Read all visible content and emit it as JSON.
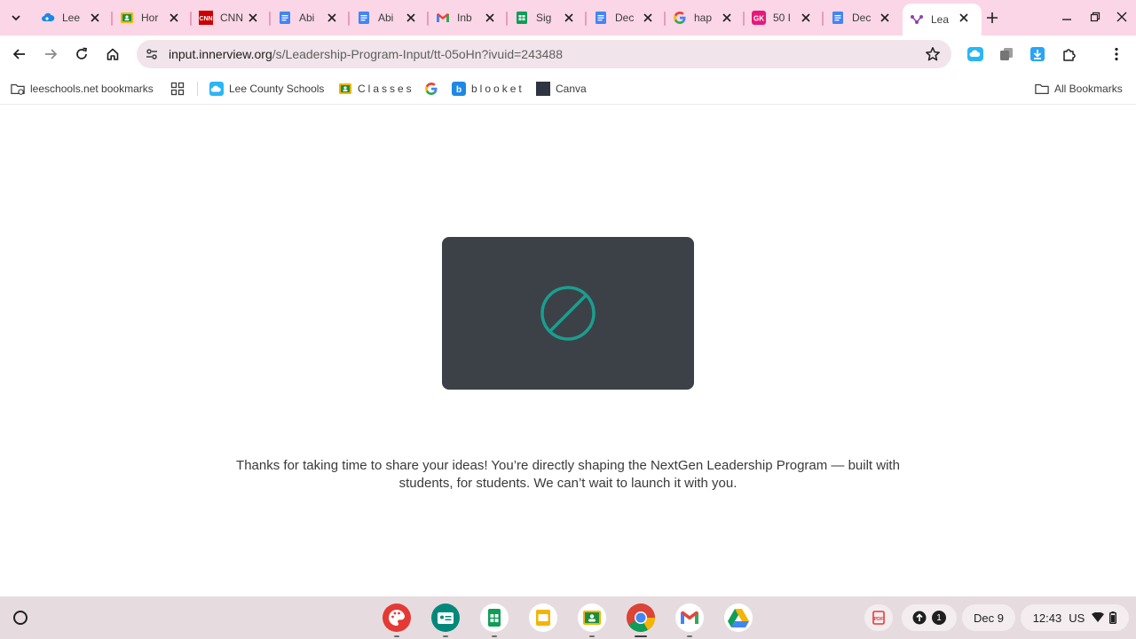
{
  "tabs": [
    {
      "title": "Lee",
      "icon": "onedrive-cloud-icon"
    },
    {
      "title": "Hor",
      "icon": "google-classroom-icon"
    },
    {
      "title": "CNN",
      "icon": "cnn-icon"
    },
    {
      "title": "Abi",
      "icon": "google-docs-icon"
    },
    {
      "title": "Abi",
      "icon": "google-docs-icon"
    },
    {
      "title": "Inb",
      "icon": "gmail-icon"
    },
    {
      "title": "Sig",
      "icon": "google-sheets-icon"
    },
    {
      "title": "Dec",
      "icon": "google-docs-icon"
    },
    {
      "title": "hap",
      "icon": "google-g-icon"
    },
    {
      "title": "50 I",
      "icon": "gimkit-icon"
    },
    {
      "title": "Dec",
      "icon": "google-docs-icon"
    },
    {
      "title": "Lea",
      "icon": "innerview-icon",
      "active": true
    }
  ],
  "omnibox": {
    "host": "input.innerview.org",
    "path": "/s/Leadership-Program-Input/tt-05oHn?ivuid=243488"
  },
  "bookmarks": {
    "managed": "leeschools.net bookmarks",
    "lee_county": "Lee County Schools",
    "classes": "Classes",
    "blooket": "blooket",
    "canva": "Canva",
    "all": "All Bookmarks"
  },
  "content": {
    "message_line1": "Thanks for taking  time to share your ideas! You’re directly shaping the NextGen Leadership Program — built with",
    "message_line2": "students, for students. We can’t wait to launch it with you.",
    "video_icon": "blocked-circle-icon"
  },
  "shelf": {
    "notification_count": "1",
    "date": "Dec 9",
    "time": "12:43",
    "locale": "US"
  },
  "colors": {
    "tabstrip": "#fbd6e6",
    "omnibox": "#f1e4ea",
    "video_bg": "#3c4148",
    "block_icon": "#1a9e8f",
    "shelf": "#e6dcdf"
  }
}
